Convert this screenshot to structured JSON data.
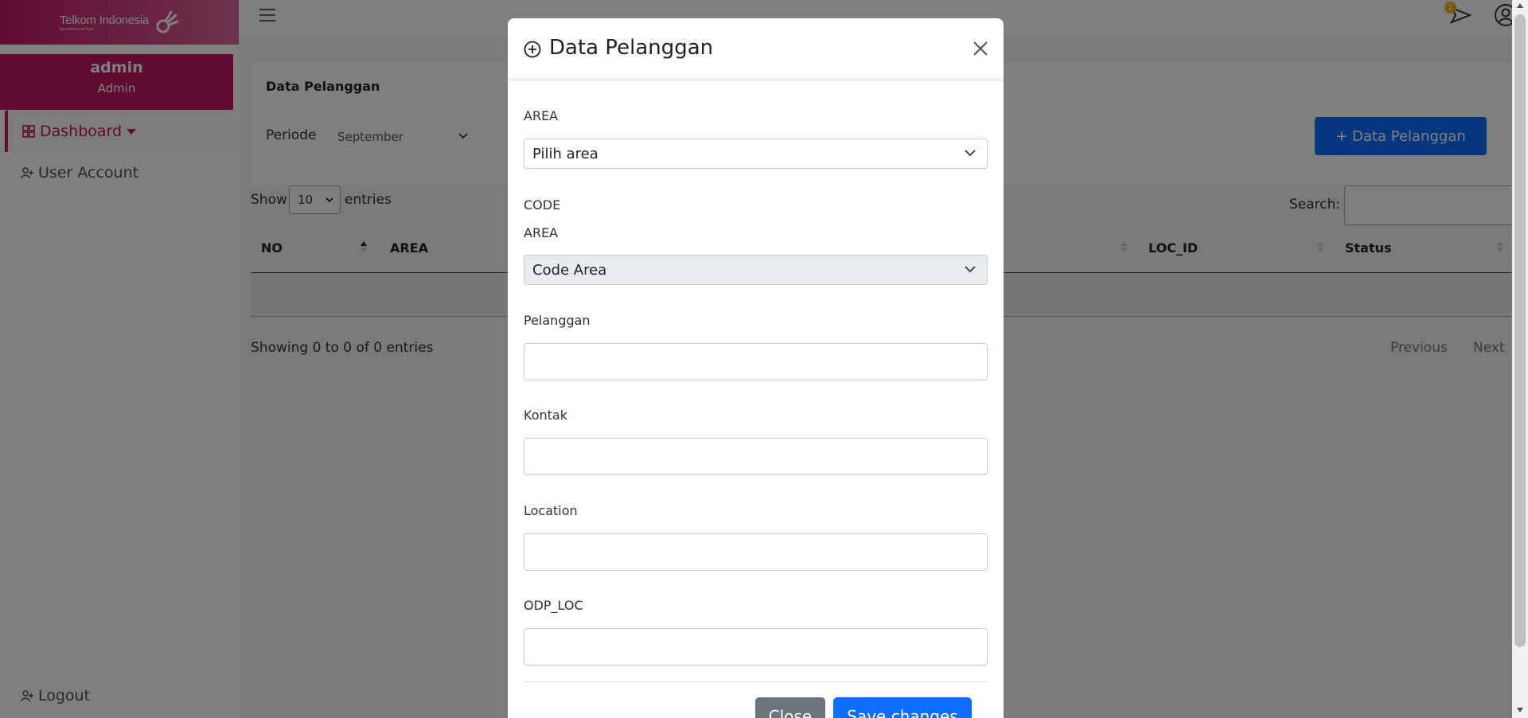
{
  "brand": {
    "name": "Telkom Indonesia",
    "tagline": "the world in your hand"
  },
  "user": {
    "name": "admin",
    "role": "Admin"
  },
  "sidebar": {
    "items": [
      {
        "label": "Dashboard"
      },
      {
        "label": "User Account"
      }
    ],
    "logout": "Logout"
  },
  "topbar": {
    "notification_count": "1"
  },
  "page": {
    "title": "Data Pelanggan",
    "periode_label": "Periode",
    "periode_value": "September",
    "add_button": "+ Data Pelanggan"
  },
  "table": {
    "show_label": "Show",
    "show_value": "10",
    "entries_label": "entries",
    "search_label": "Search:",
    "columns": [
      "NO",
      "AREA",
      "LOC_ID",
      "Status"
    ],
    "showing": "Showing 0 to 0 of 0 entries",
    "previous": "Previous",
    "next": "Next"
  },
  "modal": {
    "title": "Data Pelanggan",
    "area_label": "AREA",
    "area_placeholder": "Pilih area",
    "code_label": "CODE",
    "code_area_label": "AREA",
    "code_area_value": "Code Area",
    "pelanggan_label": "Pelanggan",
    "kontak_label": "Kontak",
    "location_label": "Location",
    "odp_label": "ODP_LOC",
    "close_button": "Close",
    "save_button": "Save changes"
  },
  "colors": {
    "brand": "#c51662",
    "primary": "#0d6efd",
    "secondary": "#6c757d"
  }
}
